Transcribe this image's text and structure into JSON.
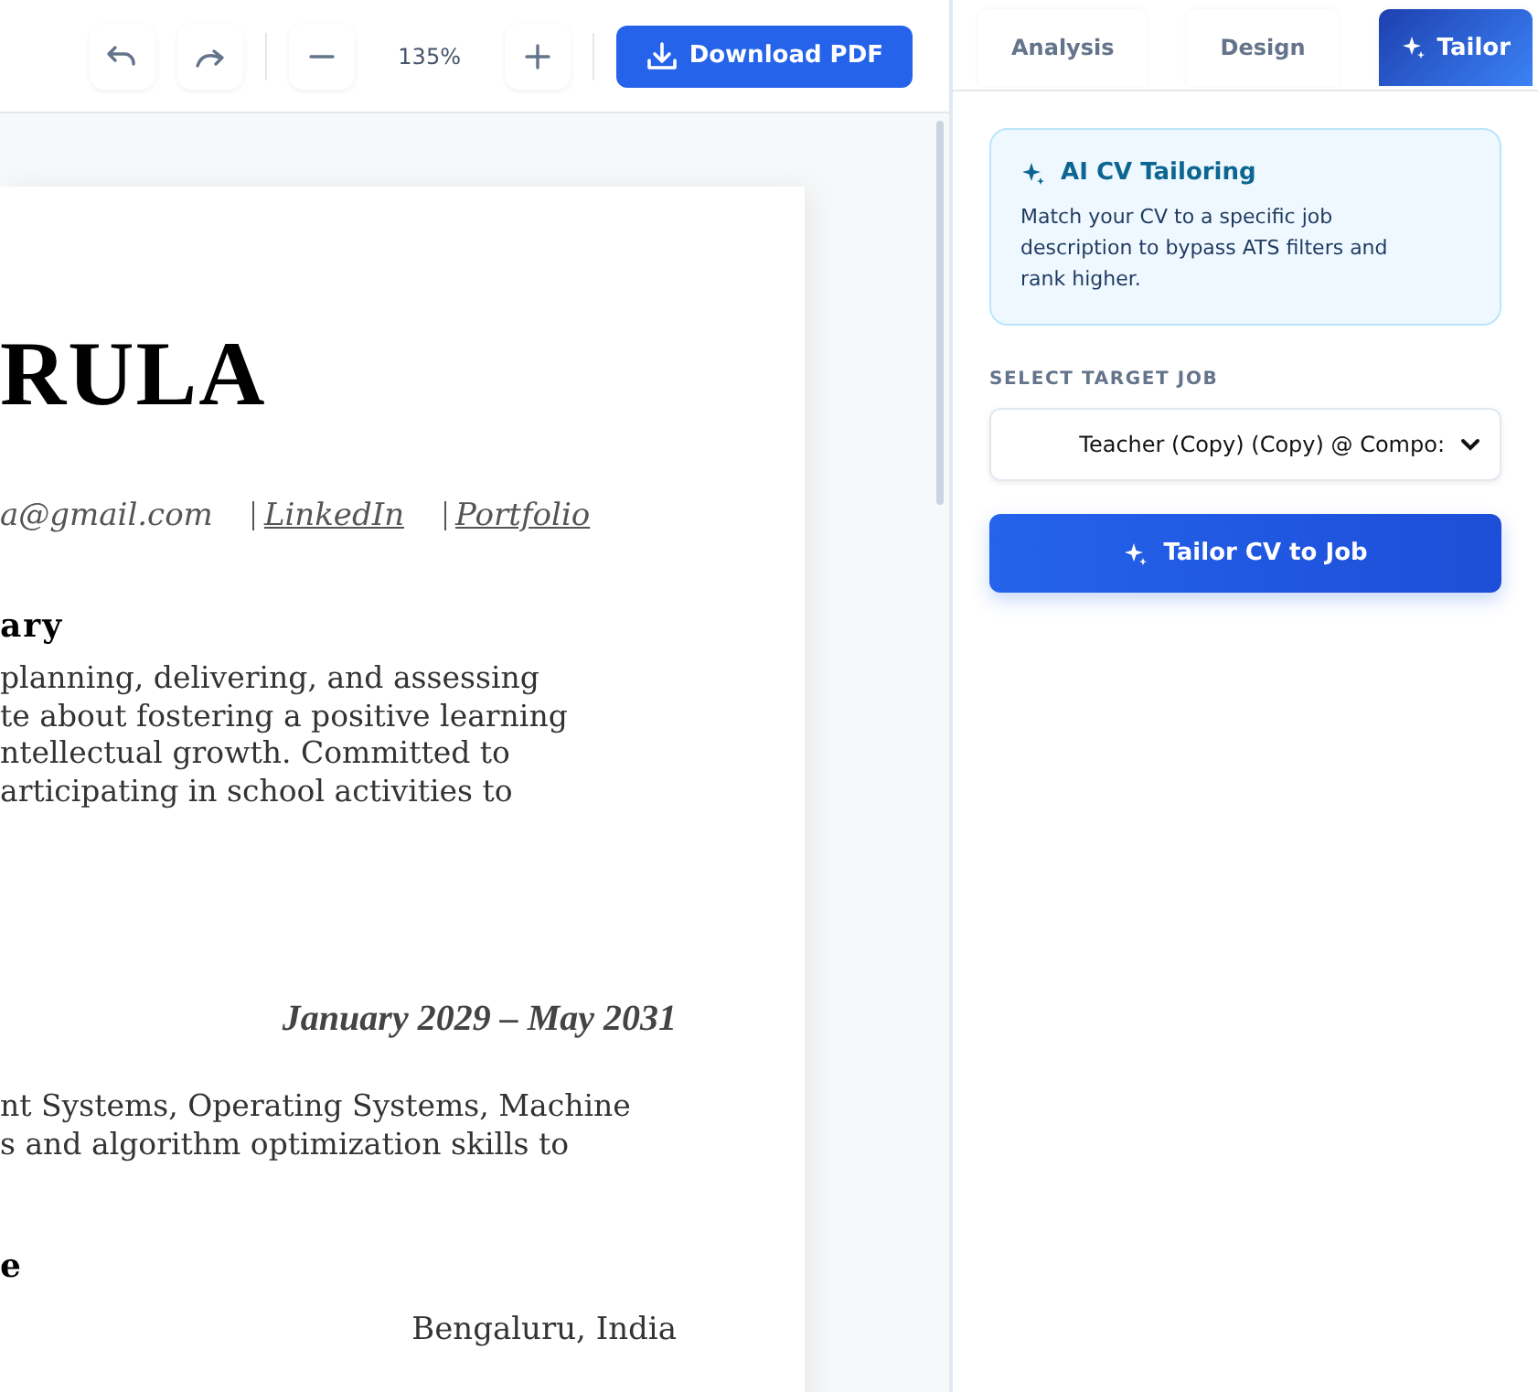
{
  "toolbar": {
    "zoom": "135%",
    "download_button": "Download PDF"
  },
  "document": {
    "name": "RULA",
    "contacts": [
      {
        "kind": "text",
        "text": "a@gmail.com"
      },
      {
        "kind": "link",
        "text": "LinkedIn"
      },
      {
        "kind": "link",
        "text": "Portfolio"
      }
    ],
    "sections": [
      {
        "kind": "heading",
        "lines": [
          "ary"
        ]
      },
      {
        "kind": "paragraph",
        "lines": [
          "planning, delivering, and assessing",
          "te about fostering a positive learning",
          "ntellectual growth. Committed to",
          "articipating in school activities to"
        ]
      },
      {
        "kind": "date",
        "lines": [
          "January 2029 – May 2031"
        ]
      },
      {
        "kind": "paragraph",
        "lines": [
          "nt Systems, Operating Systems, Machine",
          "s and algorithm optimization skills to"
        ]
      },
      {
        "kind": "heading",
        "lines": [
          "e"
        ]
      },
      {
        "kind": "location",
        "lines": [
          "Bengaluru, India"
        ]
      }
    ]
  },
  "tabs": [
    {
      "label": "Analysis",
      "selected": false
    },
    {
      "label": "Design",
      "selected": false
    },
    {
      "label": "Tailor",
      "selected": true
    }
  ],
  "info_card": {
    "title": "AI CV Tailoring",
    "text": "Match your CV to a specific job description to bypass ATS filters and rank higher."
  },
  "target_job": {
    "label": "SELECT TARGET JOB",
    "value": "Teacher (Copy) (Copy) @ Compo:"
  },
  "tailor_button": "Tailor CV to Job"
}
